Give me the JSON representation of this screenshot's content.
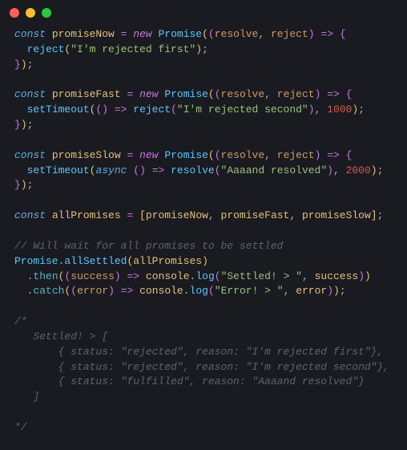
{
  "titlebar": {
    "dots": [
      "close",
      "minimize",
      "maximize"
    ]
  },
  "code": {
    "kw_const": "const",
    "kw_new": "new",
    "kw_async": "async",
    "cls_promise": "Promise",
    "id_promiseNow": "promiseNow",
    "id_promiseFast": "promiseFast",
    "id_promiseSlow": "promiseSlow",
    "id_allPromises": "allPromises",
    "fn_reject": "reject",
    "fn_resolve": "resolve",
    "fn_setTimeout": "setTimeout",
    "fn_allSettled": "allSettled",
    "fn_then": "then",
    "fn_catch": "catch",
    "fn_log": "log",
    "id_console": "console",
    "p_resolve": "resolve",
    "p_reject": "reject",
    "p_success": "success",
    "p_error": "error",
    "str_rejFirst": "\"I'm rejected first\"",
    "str_rejSecond": "\"I'm rejected second\"",
    "str_resolved": "\"Aaaand resolved\"",
    "str_settled": "\"Settled! > \"",
    "str_error": "\"Error! > \"",
    "num_1000": "1000",
    "num_2000": "2000",
    "arrow": "=>",
    "eq": "=",
    "c1": "// Will wait for all promises to be settled",
    "c2_open": "/*",
    "c2_l1": "   Settled! > [",
    "c2_l2": "       { status: \"rejected\", reason: \"I'm rejected first\"},",
    "c2_l3": "       { status: \"rejected\", reason: \"I'm rejected second\"},",
    "c2_l4": "       { status: \"fulfilled\", reason: \"Aaaand resolved\"}",
    "c2_l5": "   ]",
    "c2_close": "*/"
  }
}
